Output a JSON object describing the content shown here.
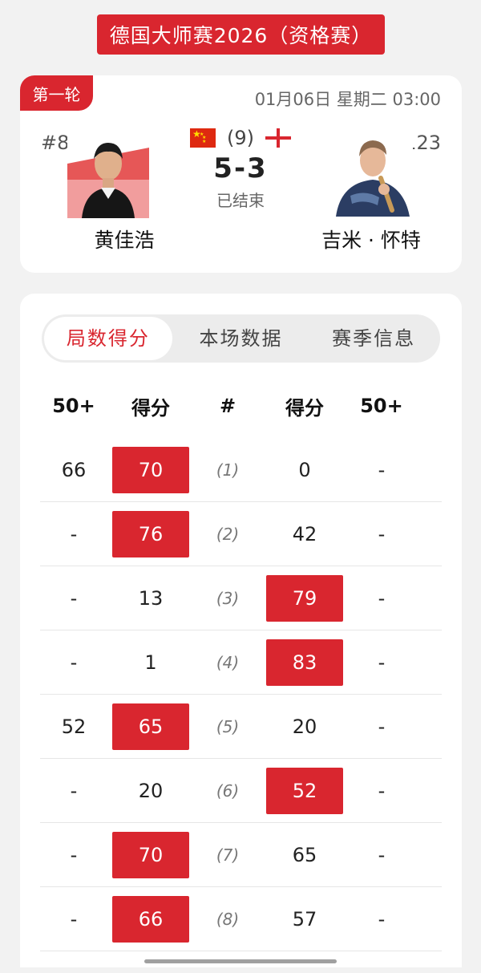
{
  "header": {
    "title": "德国大师赛2026（资格赛）"
  },
  "match": {
    "round": "第一轮",
    "datetime": "01月06日 星期二 03:00",
    "left_player": {
      "rank": "#86",
      "name": "黄佳浩",
      "flag": "china-flag"
    },
    "right_player": {
      "rank": "#123",
      "name": "吉米 · 怀特",
      "flag": "england-flag"
    },
    "frames_total": "(9)",
    "score": "5-3",
    "status": "已结束"
  },
  "tabs": [
    {
      "label": "局数得分",
      "active": true
    },
    {
      "label": "本场数据",
      "active": false
    },
    {
      "label": "赛季信息",
      "active": false
    }
  ],
  "table": {
    "headers": [
      "50+",
      "得分",
      "#",
      "得分",
      "50+"
    ],
    "rows": [
      {
        "left_50": "66",
        "left_score": "70",
        "frame": "(1)",
        "right_score": "0",
        "right_50": "-",
        "winner": "left"
      },
      {
        "left_50": "-",
        "left_score": "76",
        "frame": "(2)",
        "right_score": "42",
        "right_50": "-",
        "winner": "left"
      },
      {
        "left_50": "-",
        "left_score": "13",
        "frame": "(3)",
        "right_score": "79",
        "right_50": "-",
        "winner": "right"
      },
      {
        "left_50": "-",
        "left_score": "1",
        "frame": "(4)",
        "right_score": "83",
        "right_50": "-",
        "winner": "right"
      },
      {
        "left_50": "52",
        "left_score": "65",
        "frame": "(5)",
        "right_score": "20",
        "right_50": "-",
        "winner": "left"
      },
      {
        "left_50": "-",
        "left_score": "20",
        "frame": "(6)",
        "right_score": "52",
        "right_50": "-",
        "winner": "right"
      },
      {
        "left_50": "-",
        "left_score": "70",
        "frame": "(7)",
        "right_score": "65",
        "right_50": "-",
        "winner": "left"
      },
      {
        "left_50": "-",
        "left_score": "66",
        "frame": "(8)",
        "right_score": "57",
        "right_50": "-",
        "winner": "left"
      }
    ]
  },
  "colors": {
    "accent": "#d9262f",
    "background": "#f2f2f2",
    "card": "#ffffff"
  }
}
